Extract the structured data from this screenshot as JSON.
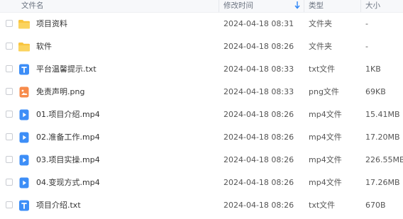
{
  "columns": {
    "name": "文件名",
    "modified": "修改时间",
    "type": "类型",
    "size": "大小"
  },
  "sort": {
    "column": "modified",
    "direction": "down",
    "icon": "arrow-down-icon"
  },
  "colors": {
    "accent": "#2f86f6",
    "folder": "#f9c53f",
    "image_icon": "#f78b4b"
  },
  "rows": [
    {
      "name": "项目资料",
      "modified": "2024-04-18 08:31",
      "type": "文件夹",
      "size": "-",
      "icon": "folder-icon"
    },
    {
      "name": "软件",
      "modified": "2024-04-18 08:26",
      "type": "文件夹",
      "size": "-",
      "icon": "folder-icon"
    },
    {
      "name": "平台温馨提示.txt",
      "modified": "2024-04-18 08:33",
      "type": "txt文件",
      "size": "1KB",
      "icon": "text-file-icon"
    },
    {
      "name": "免责声明.png",
      "modified": "2024-04-18 08:33",
      "type": "png文件",
      "size": "69KB",
      "icon": "image-file-icon"
    },
    {
      "name": "01.项目介绍.mp4",
      "modified": "2024-04-18 08:26",
      "type": "mp4文件",
      "size": "15.41MB",
      "icon": "video-file-icon"
    },
    {
      "name": "02.准备工作.mp4",
      "modified": "2024-04-18 08:26",
      "type": "mp4文件",
      "size": "17.20MB",
      "icon": "video-file-icon"
    },
    {
      "name": "03.项目实操.mp4",
      "modified": "2024-04-18 08:26",
      "type": "mp4文件",
      "size": "226.55MB",
      "icon": "video-file-icon"
    },
    {
      "name": "04.变现方式.mp4",
      "modified": "2024-04-18 08:26",
      "type": "mp4文件",
      "size": "17.26MB",
      "icon": "video-file-icon"
    },
    {
      "name": "项目介绍.txt",
      "modified": "2024-04-18 08:26",
      "type": "txt文件",
      "size": "670B",
      "icon": "text-file-icon"
    }
  ]
}
